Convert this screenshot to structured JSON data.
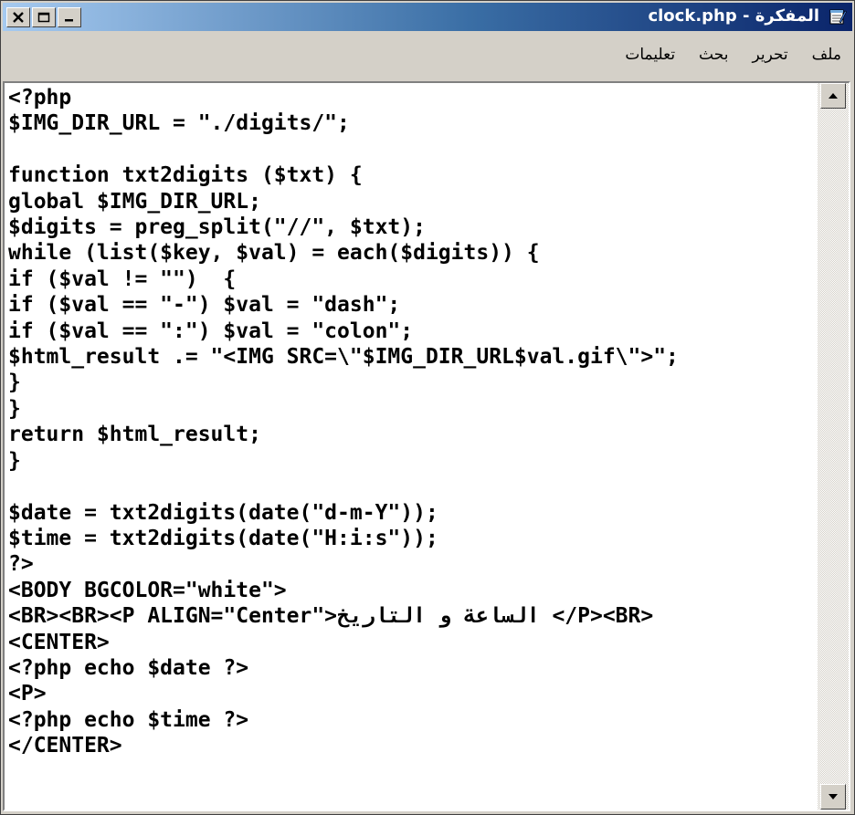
{
  "window": {
    "title": "المفكرة - clock.php",
    "icon": "notepad-icon",
    "controls": [
      "close-icon",
      "maximize-icon",
      "minimize-icon"
    ]
  },
  "menu": {
    "items": [
      "ملف",
      "تحرير",
      "بحث",
      "تعليمات"
    ]
  },
  "editor": {
    "lines": [
      "<?php",
      "$IMG_DIR_URL = \"./digits/\";",
      "",
      "function txt2digits ($txt) {",
      "global $IMG_DIR_URL;",
      "$digits = preg_split(\"//\", $txt);",
      "while (list($key, $val) = each($digits)) {",
      "if ($val != \"\")  {",
      "if ($val == \"-\") $val = \"dash\";",
      "if ($val == \":\") $val = \"colon\";",
      "$html_result .= \"<IMG SRC=\\\"$IMG_DIR_URL$val.gif\\\">\";",
      "}",
      "}",
      "return $html_result;",
      "}",
      "",
      "$date = txt2digits(date(\"d-m-Y\"));",
      "$time = txt2digits(date(\"H:i:s\"));",
      "?>",
      "<BODY BGCOLOR=\"white\">",
      "<BR><BR><P ALIGN=\"Center\">الساعة و التاريخ </P><BR>",
      "<CENTER>",
      "<?php echo $date ?>",
      "<P>",
      "<?php echo $time ?>",
      "</CENTER>"
    ]
  },
  "scrollbar": {
    "up_icon": "scroll-up-arrow-icon",
    "down_icon": "scroll-down-arrow-icon"
  }
}
